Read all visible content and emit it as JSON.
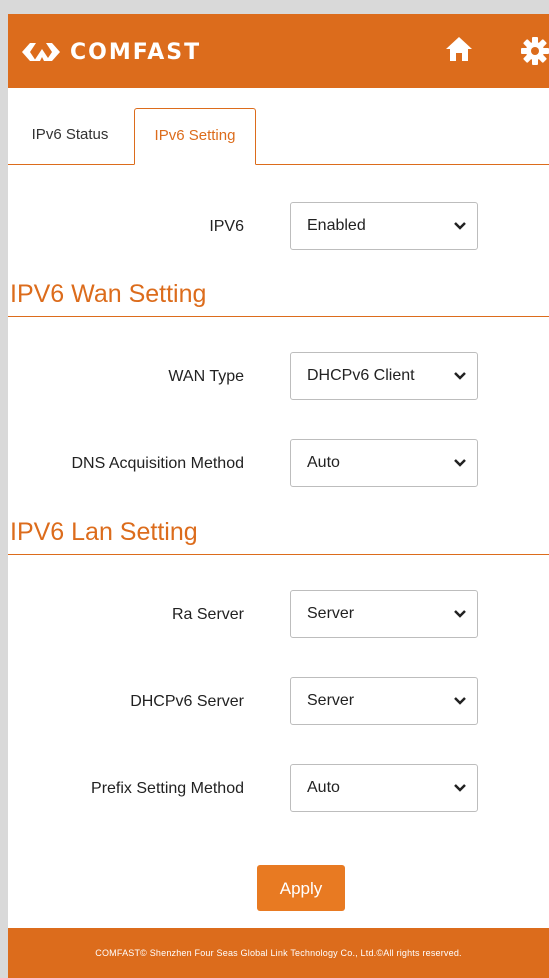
{
  "header": {
    "logo_text": "COMFAST",
    "home_icon": "home-icon",
    "settings_icon": "gear-icon",
    "accent_color": "#dc6c1c"
  },
  "tabs": [
    {
      "label": "IPv6 Status",
      "active": false
    },
    {
      "label": "IPv6 Setting",
      "active": true
    }
  ],
  "ipv6": {
    "label": "IPV6",
    "value": "Enabled"
  },
  "wan_section": {
    "title": "IPV6 Wan Setting",
    "wan_type": {
      "label": "WAN Type",
      "value": "DHCPv6 Client"
    },
    "dns_method": {
      "label": "DNS Acquisition Method",
      "value": "Auto"
    }
  },
  "lan_section": {
    "title": "IPV6 Lan Setting",
    "ra_server": {
      "label": "Ra Server",
      "value": "Server"
    },
    "dhcpv6_server": {
      "label": "DHCPv6 Server",
      "value": "Server"
    },
    "prefix_method": {
      "label": "Prefix Setting Method",
      "value": "Auto"
    }
  },
  "actions": {
    "apply_label": "Apply"
  },
  "footer": {
    "text": "COMFAST© Shenzhen Four Seas Global Link Technology Co., Ltd.©All rights reserved."
  }
}
